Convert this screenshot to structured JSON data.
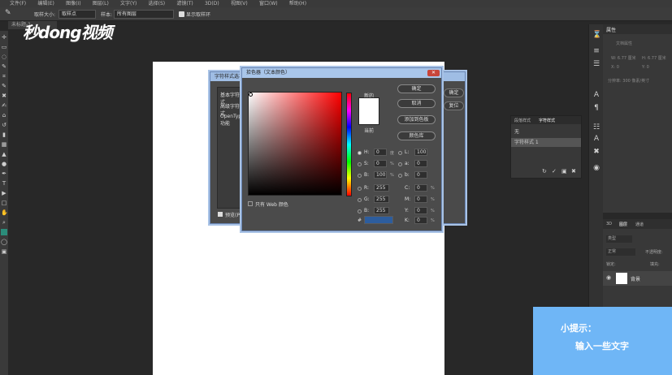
{
  "menubar": {
    "items": [
      "文件(F)",
      "编辑(E)",
      "图像(I)",
      "图层(L)",
      "文字(Y)",
      "选择(S)",
      "滤镜(T)",
      "3D(D)",
      "视图(V)",
      "窗口(W)",
      "帮助(H)"
    ]
  },
  "options": {
    "sample_size_label": "取样大小:",
    "sample_size_value": "取样点",
    "sample_label": "样本:",
    "sample_value": "所有图层",
    "show_ring_label": "显示取样环"
  },
  "doc_tab": "未标题-1",
  "watermark": "秒dong视频",
  "style_dialog": {
    "title": "字符样式选项",
    "items": [
      "基本字符格式",
      "高级字符格式",
      "OpenType 功能"
    ],
    "ok": "确定",
    "reset": "复位",
    "preview_label": "预览(P)"
  },
  "picker": {
    "title": "拾色器（文本颜色）",
    "new_label": "新的",
    "current_label": "当前",
    "ok": "确定",
    "cancel": "取消",
    "add_swatch": "添加到色板",
    "color_library": "颜色库",
    "only_web": "只有 Web 颜色",
    "hex_prefix": "#",
    "fields": {
      "H": "0",
      "S": "0",
      "B": "100",
      "R": "255",
      "G": "255",
      "Bv": "255",
      "L": "100",
      "a": "0",
      "b": "0",
      "C": "0",
      "M": "0",
      "Y": "0",
      "K": "0"
    },
    "units": {
      "deg": "度",
      "pct": "%"
    }
  },
  "props_panel": {
    "tab": "属性",
    "sub": "文档属性",
    "w": "W: 6.77 厘米",
    "h": "H: 6.77 厘米",
    "x": "X: 0",
    "y": "Y: 0",
    "res": "分辨率: 300 像素/英寸"
  },
  "charstyle_panel": {
    "tab1": "段落样式",
    "tab2": "字符样式",
    "none": "无",
    "style1": "字符样式 1"
  },
  "layers_panel": {
    "tab1": "3D",
    "tab2": "图层",
    "tab3": "通道",
    "kind": "类型",
    "mode": "正常",
    "opacity": "不透明度:",
    "lock": "锁定:",
    "fill": "填充:",
    "layer_name": "背景"
  },
  "hint": {
    "title": "小提示：",
    "text": "输入一些文字"
  }
}
